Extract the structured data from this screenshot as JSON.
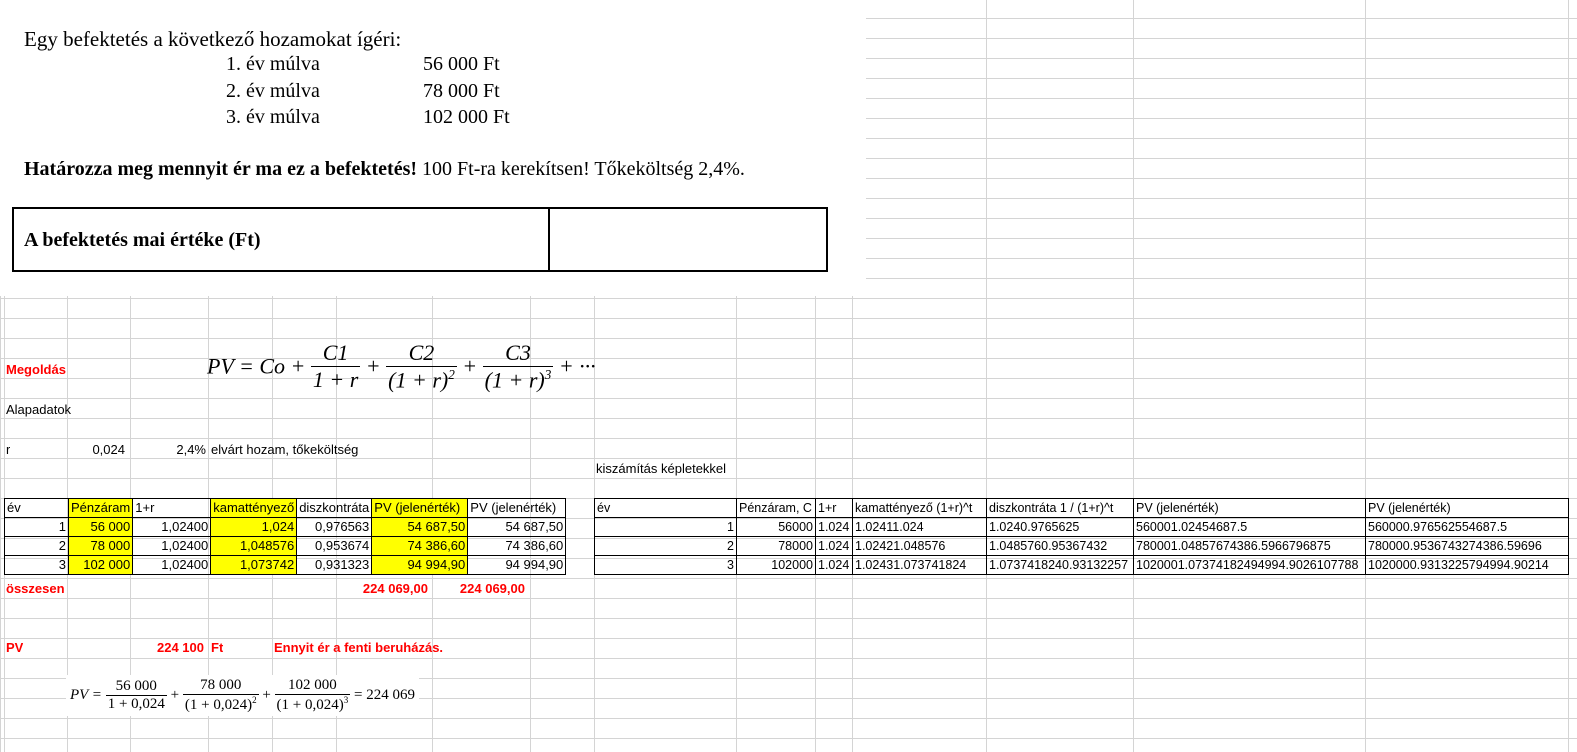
{
  "task": {
    "intro": "Egy befektetés a következő hozamokat ígéri:",
    "cashflows": [
      {
        "label": "1. év múlva",
        "amount": "56 000 Ft"
      },
      {
        "label": "2. év múlva",
        "amount": "78 000 Ft"
      },
      {
        "label": "3. év múlva",
        "amount": "102 000 Ft"
      }
    ],
    "question_bold": "Határozza meg mennyit ér ma ez a befektetés!",
    "question_rest": " 100 Ft-ra kerekítsen! Tőkeköltség 2,4%.",
    "answer_label": "A befektetés mai értéke (Ft)"
  },
  "sheet": {
    "megoldas": "Megoldás",
    "alapadatok": "Alapadatok",
    "r_label": "r",
    "r_value": "0,024",
    "r_pct": "2,4%",
    "r_desc": "elvárt hozam, tőkeköltség",
    "formula_caption": "kiszámítás képletekkel",
    "osszesen": "összesen",
    "total1": "224 069,00",
    "total2": "224 069,00",
    "pv_label": "PV",
    "pv_value": "224 100",
    "pv_unit": "Ft",
    "pv_note": "Ennyit ér a fenti beruházás."
  },
  "formula1": {
    "lhs": "PV = Co +",
    "t1_num": "C1",
    "t1_den": "1 + r",
    "t2_num": "C2",
    "t2_den": "(1 + r)",
    "t2_exp": "2",
    "t3_num": "C3",
    "t3_den": "(1 + r)",
    "t3_exp": "3",
    "tail": "+ ···"
  },
  "formula2": {
    "lhs": "PV =",
    "t1_num": "56 000",
    "t1_den": "1 + 0,024",
    "t2_num": "78 000",
    "t2_den": "(1 + 0,024)",
    "t2_exp": "2",
    "t3_num": "102 000",
    "t3_den": "(1 + 0,024)",
    "t3_exp": "3",
    "result": "= 224 069"
  },
  "table1": {
    "headers": [
      "év",
      "Pénzáram",
      "1+r",
      "kamattényező",
      "diszkontráta",
      "PV (jelenérték)",
      "PV (jelenérték)"
    ],
    "rows": [
      [
        "1",
        "56 000",
        "1,02400",
        "1,024",
        "0,976563",
        "54 687,50",
        "54 687,50"
      ],
      [
        "2",
        "78 000",
        "1,02400",
        "1,048576",
        "0,953674",
        "74 386,60",
        "74 386,60"
      ],
      [
        "3",
        "102 000",
        "1,02400",
        "1,073742",
        "0,931323",
        "94 994,90",
        "94 994,90"
      ]
    ]
  },
  "table2": {
    "headers": [
      "év",
      "Pénzáram, C",
      "1+r",
      "kamattényező (1+r)^t",
      "diszkontráta 1 / (1+r)^t",
      "PV (jelenérték)",
      "PV (jelenérték)"
    ],
    "rows": [
      [
        "1",
        "56000",
        "1.024",
        "1.02411.024",
        "1.0240.9765625",
        "560001.02454687.5",
        "560000.976562554687.5"
      ],
      [
        "2",
        "78000",
        "1.024",
        "1.02421.048576",
        "1.0485760.95367432",
        "780001.04857674386.5966796875",
        "780000.9536743274386.59696"
      ],
      [
        "3",
        "102000",
        "1.024",
        "1.02431.073741824",
        "1.0737418240.93132257",
        "1020001.07374182494994.9026107788",
        "1020000.9313225794994.90214"
      ]
    ]
  }
}
